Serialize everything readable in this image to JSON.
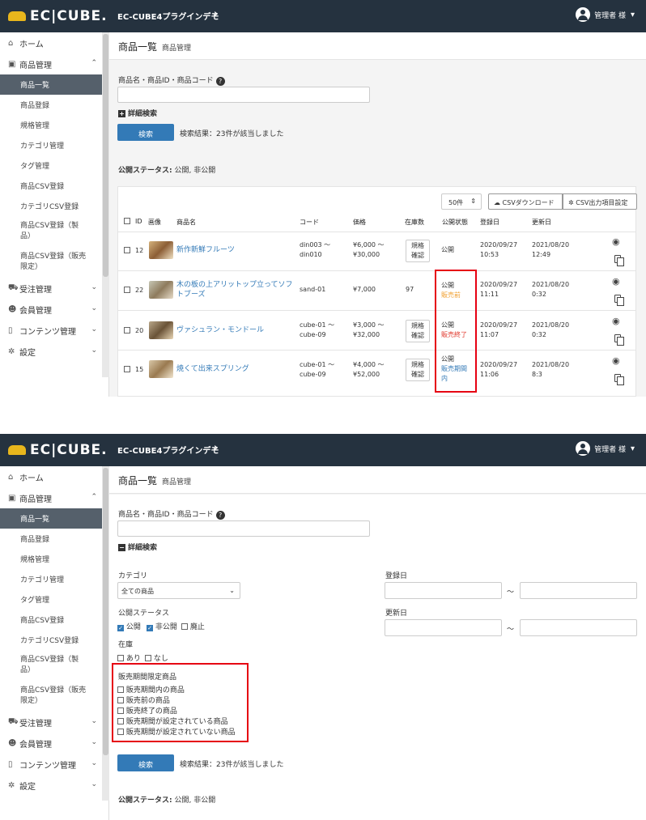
{
  "brand": {
    "logo": "EC|CUBE.",
    "logo_accent": "#e8b61c",
    "topbar_color": "#25323f",
    "link_color": "#337ab7",
    "highlight_color": "#e60012"
  },
  "header": {
    "site_name": "EC-CUBE4プラグインデモ",
    "site_chevron": "chevron-right-icon",
    "user_name": "管理者 様",
    "user_icon": "user-circle-icon",
    "user_chevron": "chevron-down-icon"
  },
  "sidebar": {
    "home": "ホーム",
    "product_mgmt": "商品管理",
    "sub_items": [
      "商品一覧",
      "商品登録",
      "規格管理",
      "カテゴリ管理",
      "タグ管理",
      "商品CSV登録",
      "カテゴリCSV登録",
      "商品CSV登録（製\n品）",
      "商品CSV登録（販売\n限定）"
    ],
    "order_mgmt": "受注管理",
    "member_mgmt": "会員管理",
    "content_mgmt": "コンテンツ管理",
    "settings": "設定"
  },
  "page": {
    "title": "商品一覧",
    "subtitle": "商品管理"
  },
  "search": {
    "label": "商品名・商品ID・商品コード",
    "value": "",
    "detail_toggle": "詳細検索",
    "button": "検索",
    "result": "検索結果：23件が該当しました"
  },
  "status_filter": {
    "label": "公開ステータス:",
    "value": "公開, 非公開"
  },
  "toolbar": {
    "per_page": "50件",
    "csv_download": "CSVダウンロード",
    "csv_settings": "CSV出力項目設定"
  },
  "table": {
    "headers": [
      "ID",
      "画像",
      "商品名",
      "コード",
      "価格",
      "在庫数",
      "公開状態",
      "登録日",
      "更新日"
    ],
    "rows": [
      {
        "id": "12",
        "name": "新作新鮮フルーツ",
        "code1": "din003 ～",
        "code2": "din010",
        "price1": "¥6,000 ～",
        "price2": "¥30,000",
        "stock1": "規格",
        "stock2": "確認",
        "status1": "公開",
        "status2": "",
        "reg1": "2020/09/27",
        "reg2": "10:53",
        "upd1": "2021/08/20",
        "upd2": "12:49"
      },
      {
        "id": "22",
        "name": "木の板の上アリットップ立ってソフトブーズ",
        "code1": "sand-01",
        "code2": "",
        "price1": "¥7,000",
        "price2": "",
        "stock1": "97",
        "stock2": "",
        "status1": "公開",
        "status2": "販売前",
        "reg1": "2020/09/27",
        "reg2": "11:11",
        "upd1": "2021/08/20",
        "upd2": "0:32"
      },
      {
        "id": "20",
        "name": "ヴァシュラン・モンドール",
        "code1": "cube-01 ～",
        "code2": "cube-09",
        "price1": "¥3,000 ～",
        "price2": "¥32,000",
        "stock1": "規格",
        "stock2": "確認",
        "status1": "公開",
        "status2": "販売終了",
        "reg1": "2020/09/27",
        "reg2": "11:07",
        "upd1": "2021/08/20",
        "upd2": "0:32"
      },
      {
        "id": "15",
        "name": "焼くて出来スプリング",
        "code1": "cube-01 ～",
        "code2": "cube-09",
        "price1": "¥4,000 ～",
        "price2": "¥52,000",
        "stock1": "規格",
        "stock2": "確認",
        "status1": "公開",
        "status2": "販売期間内",
        "reg1": "2020/09/27",
        "reg2": "11:06",
        "upd1": "2021/08/20",
        "upd2": "8:3"
      }
    ]
  },
  "detail": {
    "category_label": "カテゴリ",
    "category_value": "全ての商品",
    "status_label": "公開ステータス",
    "status_options": [
      {
        "label": "公開",
        "checked": true
      },
      {
        "label": "非公開",
        "checked": true
      },
      {
        "label": "廃止",
        "checked": false
      }
    ],
    "stock_label": "在庫",
    "stock_options": [
      {
        "label": "あり",
        "checked": false
      },
      {
        "label": "なし",
        "checked": false
      }
    ],
    "sale_label": "販売期間限定商品",
    "sale_options": [
      "販売期間内の商品",
      "販売前の商品",
      "販売終了の商品",
      "販売期間が設定されている商品",
      "販売期間が設定されていない商品"
    ],
    "reg_date_label": "登録日",
    "upd_date_label": "更新日",
    "range_sep": "～"
  }
}
